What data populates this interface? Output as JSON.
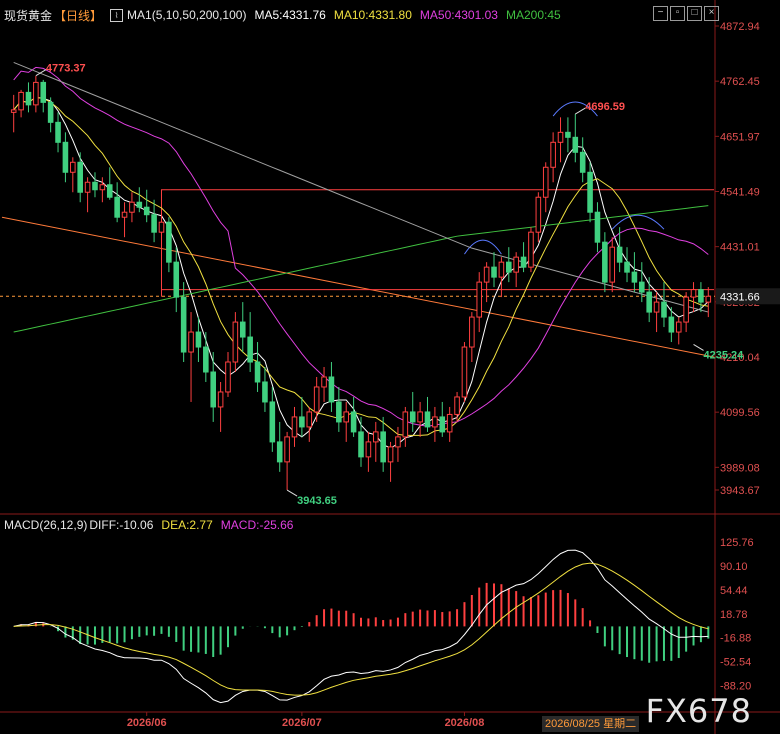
{
  "header": {
    "symbol": "现货黄金",
    "period": "【日线】",
    "ma_label": "MA1(5,10,50,200,100)",
    "ma5": "MA5:4331.76",
    "ma10": "MA10:4331.80",
    "ma50": "MA50:4301.03",
    "ma200": "MA200:45",
    "colors": {
      "ma5": "#ffffff",
      "ma10": "#f0e040",
      "ma50": "#e040e0",
      "ma200": "#40c040",
      "ma100": "#a0a0a0"
    }
  },
  "macd_header": {
    "label": "MACD(26,12,9)",
    "diff": "DIFF:-10.06",
    "dea": "DEA:2.77",
    "macd": "MACD:-25.66"
  },
  "toolbar": {
    "minus_icon": "minus-icon",
    "restore_icon": "restore-icon",
    "maximize_icon": "maximize-icon",
    "close_icon": "close-icon"
  },
  "watermark": "FX678",
  "cursor_date": "2026/08/25 星期二",
  "chart_data": {
    "type": "candlestick",
    "ylim": [
      3943.67,
      4872.94
    ],
    "price_ticks": [
      4872.94,
      4762.45,
      4651.97,
      4541.49,
      4431.01,
      4320.52,
      4210.04,
      4099.56,
      3989.08,
      3943.67
    ],
    "last_price_label": "4331.66",
    "macd_ticks": [
      "125.76",
      "90.10",
      "54.44",
      "18.78",
      "-16.88",
      "-52.54",
      "-88.20"
    ],
    "macd_ylim": [
      -95,
      135
    ],
    "x_ticks": [
      {
        "i": 18,
        "label": "2026/06"
      },
      {
        "i": 39,
        "label": "2026/07"
      },
      {
        "i": 61,
        "label": "2026/08"
      }
    ],
    "annotations": [
      {
        "i": 3,
        "price": 4773.37,
        "label": "4773.37",
        "side": "high"
      },
      {
        "i": 76,
        "price": 4696.59,
        "label": "4696.59",
        "side": "high"
      },
      {
        "i": 37,
        "price": 3943.65,
        "label": "3943.65",
        "side": "low"
      },
      {
        "i": 92,
        "price": 4235.24,
        "label": "4235.24",
        "side": "low"
      }
    ],
    "colors": {
      "up": "#ff4040",
      "down": "#40d080"
    },
    "candles": [
      [
        4700,
        4735,
        4660,
        4705
      ],
      [
        4705,
        4745,
        4690,
        4740
      ],
      [
        4740,
        4760,
        4700,
        4715
      ],
      [
        4715,
        4773,
        4700,
        4760
      ],
      [
        4760,
        4765,
        4700,
        4720
      ],
      [
        4720,
        4730,
        4660,
        4680
      ],
      [
        4680,
        4700,
        4620,
        4640
      ],
      [
        4640,
        4660,
        4560,
        4580
      ],
      [
        4580,
        4610,
        4540,
        4600
      ],
      [
        4600,
        4620,
        4520,
        4540
      ],
      [
        4540,
        4570,
        4500,
        4560
      ],
      [
        4560,
        4580,
        4530,
        4545
      ],
      [
        4545,
        4570,
        4520,
        4555
      ],
      [
        4555,
        4590,
        4525,
        4530
      ],
      [
        4530,
        4560,
        4480,
        4490
      ],
      [
        4490,
        4520,
        4450,
        4500
      ],
      [
        4500,
        4540,
        4480,
        4520
      ],
      [
        4520,
        4550,
        4500,
        4510
      ],
      [
        4510,
        4545,
        4480,
        4495
      ],
      [
        4495,
        4525,
        4440,
        4460
      ],
      [
        4460,
        4500,
        4430,
        4480
      ],
      [
        4480,
        4490,
        4380,
        4400
      ],
      [
        4400,
        4430,
        4300,
        4330
      ],
      [
        4330,
        4360,
        4200,
        4220
      ],
      [
        4220,
        4300,
        4120,
        4260
      ],
      [
        4260,
        4290,
        4200,
        4230
      ],
      [
        4230,
        4260,
        4160,
        4180
      ],
      [
        4180,
        4220,
        4080,
        4110
      ],
      [
        4110,
        4160,
        4060,
        4140
      ],
      [
        4140,
        4220,
        4130,
        4200
      ],
      [
        4200,
        4300,
        4180,
        4280
      ],
      [
        4280,
        4320,
        4220,
        4250
      ],
      [
        4250,
        4300,
        4180,
        4200
      ],
      [
        4200,
        4240,
        4140,
        4160
      ],
      [
        4160,
        4190,
        4100,
        4120
      ],
      [
        4120,
        4150,
        4020,
        4040
      ],
      [
        4040,
        4080,
        3980,
        4000
      ],
      [
        4000,
        4060,
        3943.65,
        4050
      ],
      [
        4050,
        4110,
        4030,
        4090
      ],
      [
        4090,
        4130,
        4050,
        4070
      ],
      [
        4070,
        4110,
        4040,
        4100
      ],
      [
        4100,
        4170,
        4080,
        4150
      ],
      [
        4150,
        4190,
        4120,
        4170
      ],
      [
        4170,
        4200,
        4100,
        4120
      ],
      [
        4120,
        4150,
        4060,
        4080
      ],
      [
        4080,
        4120,
        4040,
        4100
      ],
      [
        4100,
        4130,
        4050,
        4060
      ],
      [
        4060,
        4090,
        3990,
        4010
      ],
      [
        4010,
        4060,
        3980,
        4040
      ],
      [
        4040,
        4080,
        4000,
        4060
      ],
      [
        4060,
        4090,
        3980,
        4000
      ],
      [
        4000,
        4040,
        3960,
        4030
      ],
      [
        4030,
        4070,
        4000,
        4050
      ],
      [
        4050,
        4110,
        4030,
        4100
      ],
      [
        4100,
        4140,
        4060,
        4080
      ],
      [
        4080,
        4120,
        4050,
        4100
      ],
      [
        4100,
        4130,
        4060,
        4070
      ],
      [
        4070,
        4110,
        4040,
        4090
      ],
      [
        4090,
        4120,
        4050,
        4060
      ],
      [
        4060,
        4110,
        4040,
        4095
      ],
      [
        4095,
        4140,
        4080,
        4130
      ],
      [
        4130,
        4240,
        4120,
        4230
      ],
      [
        4230,
        4300,
        4200,
        4290
      ],
      [
        4290,
        4380,
        4260,
        4360
      ],
      [
        4360,
        4400,
        4320,
        4390
      ],
      [
        4390,
        4420,
        4350,
        4370
      ],
      [
        4370,
        4410,
        4330,
        4400
      ],
      [
        4400,
        4430,
        4360,
        4380
      ],
      [
        4380,
        4420,
        4350,
        4410
      ],
      [
        4410,
        4440,
        4380,
        4390
      ],
      [
        4390,
        4470,
        4380,
        4460
      ],
      [
        4460,
        4540,
        4440,
        4530
      ],
      [
        4530,
        4600,
        4500,
        4590
      ],
      [
        4590,
        4660,
        4560,
        4640
      ],
      [
        4640,
        4690,
        4600,
        4660
      ],
      [
        4660,
        4690,
        4620,
        4650
      ],
      [
        4650,
        4696.59,
        4600,
        4620
      ],
      [
        4620,
        4650,
        4560,
        4580
      ],
      [
        4580,
        4600,
        4480,
        4500
      ],
      [
        4500,
        4520,
        4420,
        4440
      ],
      [
        4440,
        4460,
        4340,
        4360
      ],
      [
        4360,
        4450,
        4340,
        4430
      ],
      [
        4430,
        4470,
        4380,
        4400
      ],
      [
        4400,
        4430,
        4360,
        4380
      ],
      [
        4380,
        4420,
        4340,
        4360
      ],
      [
        4360,
        4400,
        4320,
        4340
      ],
      [
        4340,
        4370,
        4280,
        4300
      ],
      [
        4300,
        4340,
        4260,
        4320
      ],
      [
        4320,
        4360,
        4270,
        4290
      ],
      [
        4290,
        4310,
        4240,
        4260
      ],
      [
        4260,
        4290,
        4235.24,
        4280
      ],
      [
        4280,
        4340,
        4260,
        4330
      ],
      [
        4330,
        4360,
        4300,
        4345
      ],
      [
        4345,
        4360,
        4300,
        4320
      ],
      [
        4320,
        4350,
        4290,
        4331.66
      ]
    ]
  }
}
